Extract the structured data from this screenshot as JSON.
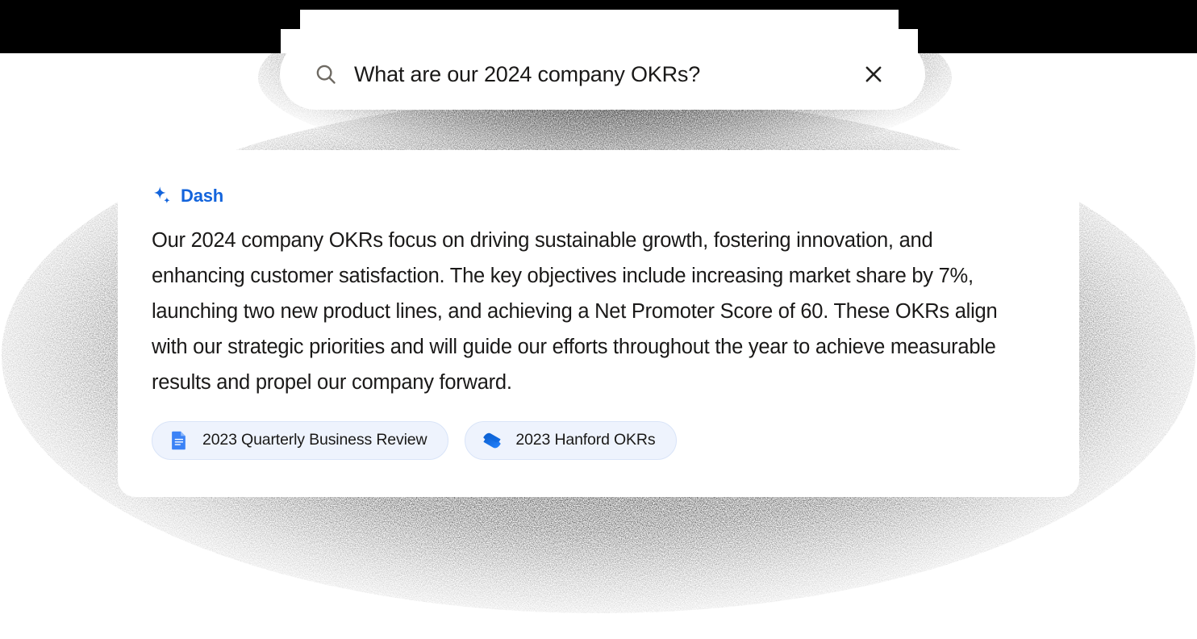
{
  "search": {
    "value": "What are our 2024 company OKRs?",
    "placeholder": "Search",
    "search_icon": "search-icon",
    "clear_icon": "close-icon"
  },
  "answer": {
    "brand_label": "Dash",
    "brand_icon": "sparkle-icon",
    "brand_color": "#1364DC",
    "text": "Our 2024 company OKRs focus on driving sustainable growth, fostering innovation, and enhancing customer satisfaction. The key objectives include increasing market share by 7%, launching two new product lines, and achieving a Net Promoter Score of 60. These OKRs align with our strategic priorities and will guide our efforts throughout the year to achieve measurable results and propel our company forward.",
    "sources": [
      {
        "label": "2023 Quarterly Business Review",
        "icon": "google-docs-icon"
      },
      {
        "label": "2023 Hanford OKRs",
        "icon": "confluence-icon"
      }
    ]
  },
  "theme": {
    "page_background": "#FFFFFF",
    "card_background": "#FFFFFF",
    "chip_background": "#EEF3FD",
    "chip_border": "#D9E4F8",
    "text_color": "#1A1918",
    "accent_blue": "#1364DC",
    "icon_gray": "#6E6A63"
  }
}
